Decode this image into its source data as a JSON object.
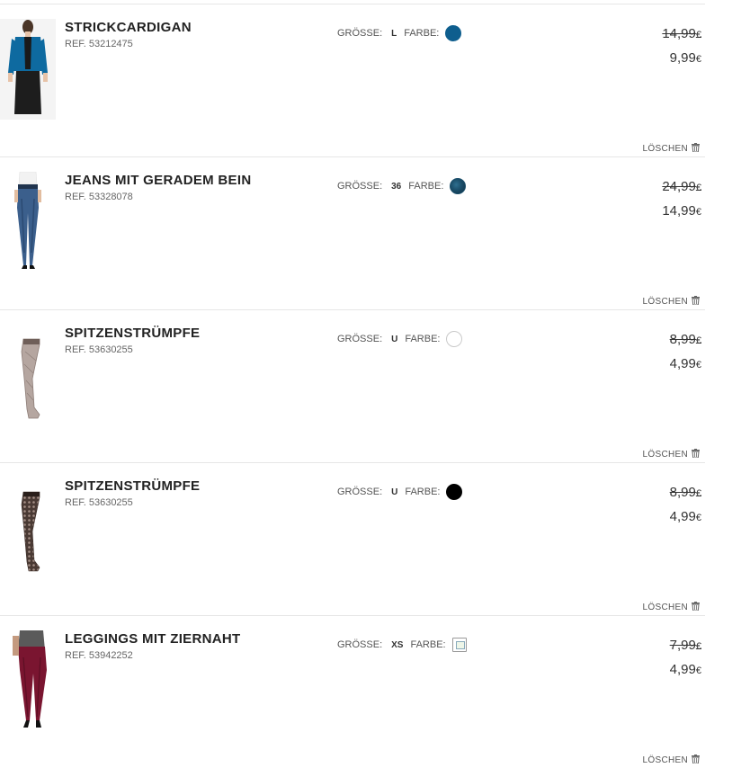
{
  "labels": {
    "size": "GRÖSSE:",
    "color": "FARBE:",
    "ref": "REF.",
    "delete": "LÖSCHEN",
    "currency": "€"
  },
  "items": [
    {
      "name": "STRICKCARDIGAN",
      "ref": "53212475",
      "size": "L",
      "color_swatch": "#0e5e8e",
      "price_old": "14,99",
      "price_new": "9,99",
      "thumb_icon": "cardigan-product-image"
    },
    {
      "name": "JEANS MIT GERADEM BEIN",
      "ref": "53328078",
      "size": "36",
      "color_swatch": "#1b4e6a",
      "price_old": "24,99",
      "price_new": "14,99",
      "thumb_icon": "jeans-product-image"
    },
    {
      "name": "SPITZENSTRÜMPFE",
      "ref": "53630255",
      "size": "U",
      "color_swatch": "#ffffff",
      "price_old": "8,99",
      "price_new": "4,99",
      "thumb_icon": "stockings-product-image"
    },
    {
      "name": "SPITZENSTRÜMPFE",
      "ref": "53630255",
      "size": "U",
      "color_swatch": "#000000",
      "price_old": "8,99",
      "price_new": "4,99",
      "thumb_icon": "lace-stockings-product-image"
    },
    {
      "name": "LEGGINGS MIT ZIERNAHT",
      "ref": "53942252",
      "size": "XS",
      "color_swatch": "broken-image-icon",
      "price_old": "7,99",
      "price_new": "4,99",
      "thumb_icon": "leggings-product-image"
    }
  ]
}
